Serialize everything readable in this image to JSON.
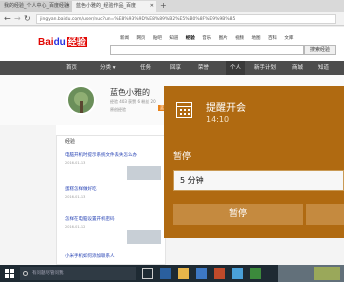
{
  "browser": {
    "tabs": [
      {
        "label": "我的经验_个人中心_百度经验"
      },
      {
        "label": "蓝色小雅的_经验作品_百度"
      }
    ],
    "url": "jingyan.baidu.com/user/nuc?un=%E8%93%9D%E8%89%B2%E5%B0%8F%E9%9B%85"
  },
  "baidu": {
    "logo_text": "Bai",
    "logo_paw": "du",
    "logo_jy": "经验",
    "topnav": [
      "新闻",
      "网页",
      "贴吧",
      "知道",
      "经验",
      "音乐",
      "图片",
      "视频",
      "地图",
      "百科",
      "文库"
    ],
    "search_button": "搜索经验",
    "mainnav": [
      "首页",
      "分类 ▾",
      "任务",
      "回享",
      "荣誉",
      "个人",
      "新手计划",
      "商城",
      "知道"
    ]
  },
  "profile": {
    "name": "蓝色小雅的",
    "stats": "经验 403  获赞 6  粉丝 20",
    "meta": "原创经验",
    "badge": "蓝色"
  },
  "content": {
    "tab": "经验",
    "items": [
      {
        "title": "电脑开机时提示系统文件丢失怎么办",
        "date": "2016-01-13"
      },
      {
        "title": "蛋糕怎样做好吃",
        "date": "2016-01-13"
      },
      {
        "title": "怎样在电脑设置开机密码",
        "date": "2016-01-12"
      },
      {
        "title": "小米手机如何添加联系人",
        "date": ""
      }
    ]
  },
  "toast": {
    "title": "提醒开会",
    "time": "14:10",
    "snooze_label": "暂停",
    "snooze_value": "5 分钟",
    "snooze_button": "暂停",
    "dismiss_button": "",
    "accent": "#b06a11"
  },
  "taskbar": {
    "search_placeholder": "有问题尽管问我"
  }
}
